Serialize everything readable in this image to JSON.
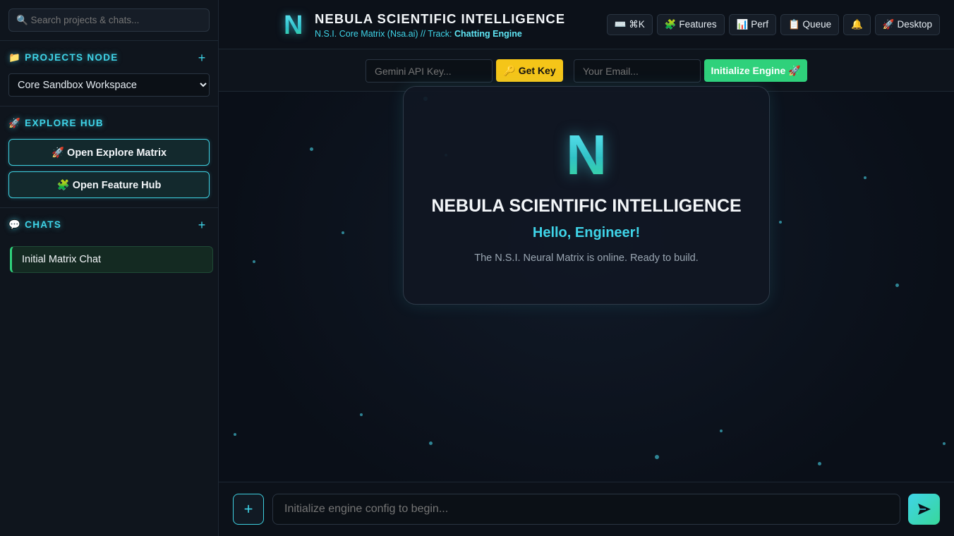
{
  "sidebar": {
    "search_placeholder": "🔍 Search projects & chats...",
    "projects": {
      "title": "📁 PROJECTS NODE",
      "add": "+",
      "selected": "Core Sandbox Workspace"
    },
    "explore": {
      "title": "🚀 EXPLORE HUB",
      "open_matrix": "🚀 Open Explore Matrix",
      "open_features": "🧩 Open Feature Hub"
    },
    "chats": {
      "title": "💬 CHATS",
      "add": "+",
      "items": [
        {
          "label": "Initial Matrix Chat"
        }
      ]
    }
  },
  "header": {
    "logo": "N",
    "title": "NEBULA SCIENTIFIC INTELLIGENCE",
    "subtitle_prefix": "N.S.I. Core Matrix (Nsa.ai) // Track: ",
    "subtitle_track": "Chatting Engine",
    "actions": [
      "⌨️ ⌘K",
      "🧩 Features",
      "📊 Perf",
      "📋 Queue",
      "🔔",
      "🚀 Desktop"
    ]
  },
  "config": {
    "api_key_placeholder": "Gemini API Key...",
    "get_key": "🔑 Get Key",
    "email_placeholder": "Your Email...",
    "init_engine": "Initialize Engine 🚀"
  },
  "welcome": {
    "logo": "N",
    "title": "NEBULA SCIENTIFIC INTELLIGENCE",
    "greeting": "Hello, Engineer!",
    "message": "The N.S.I. Neural Matrix is online. Ready to build."
  },
  "composer": {
    "add": "+",
    "placeholder": "Initialize engine config to begin..."
  },
  "colors": {
    "accent": "#3fd4e8",
    "success": "#2fd17b",
    "warning": "#f5c518"
  }
}
